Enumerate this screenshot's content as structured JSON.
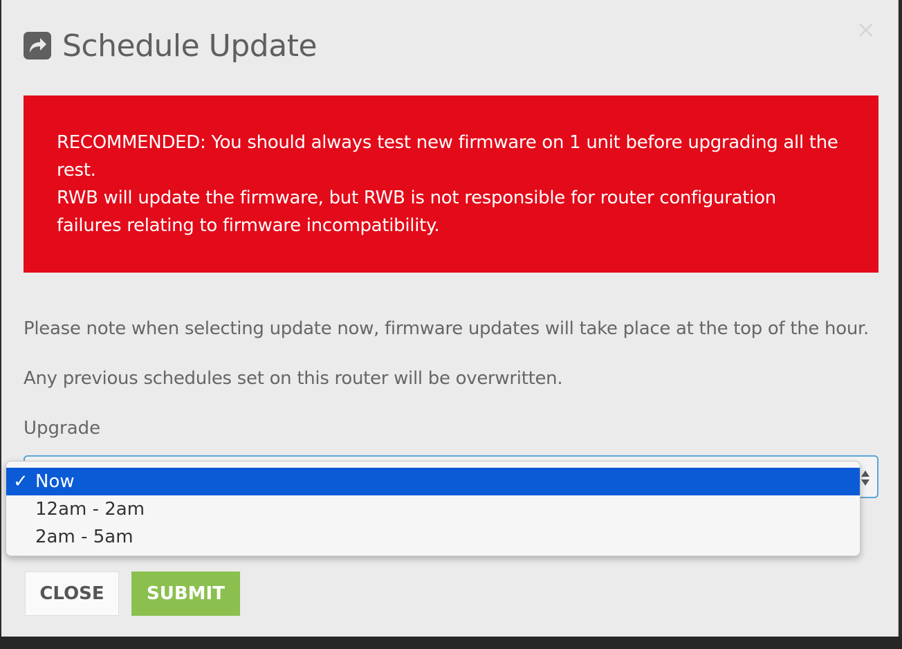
{
  "modal": {
    "title": "Schedule Update",
    "title_icon": "share-square-icon",
    "close_icon": "close-icon",
    "close_symbol": "×"
  },
  "alert": {
    "line1": "RECOMMENDED: You should always test new firmware on 1 unit before upgrading all the rest.",
    "line2": "RWB will update the firmware, but RWB is not responsible for router configuration failures relating to firmware incompatibility.",
    "background": "#e30a19"
  },
  "notes": {
    "note1": "Please note when selecting update now, firmware updates will take place at the top of the hour.",
    "note2": "Any previous schedules set on this router will be overwritten."
  },
  "upgrade": {
    "label": "Upgrade",
    "selected": "Now",
    "options": [
      "Now",
      "12am - 2am",
      "2am - 5am"
    ],
    "check_symbol": "✓"
  },
  "buttons": {
    "close_label": "CLOSE",
    "submit_label": "SUBMIT",
    "submit_color": "#8bc04f"
  },
  "colors": {
    "selected_option": "#0b5bd6",
    "focus_border": "#5aa6d9"
  }
}
